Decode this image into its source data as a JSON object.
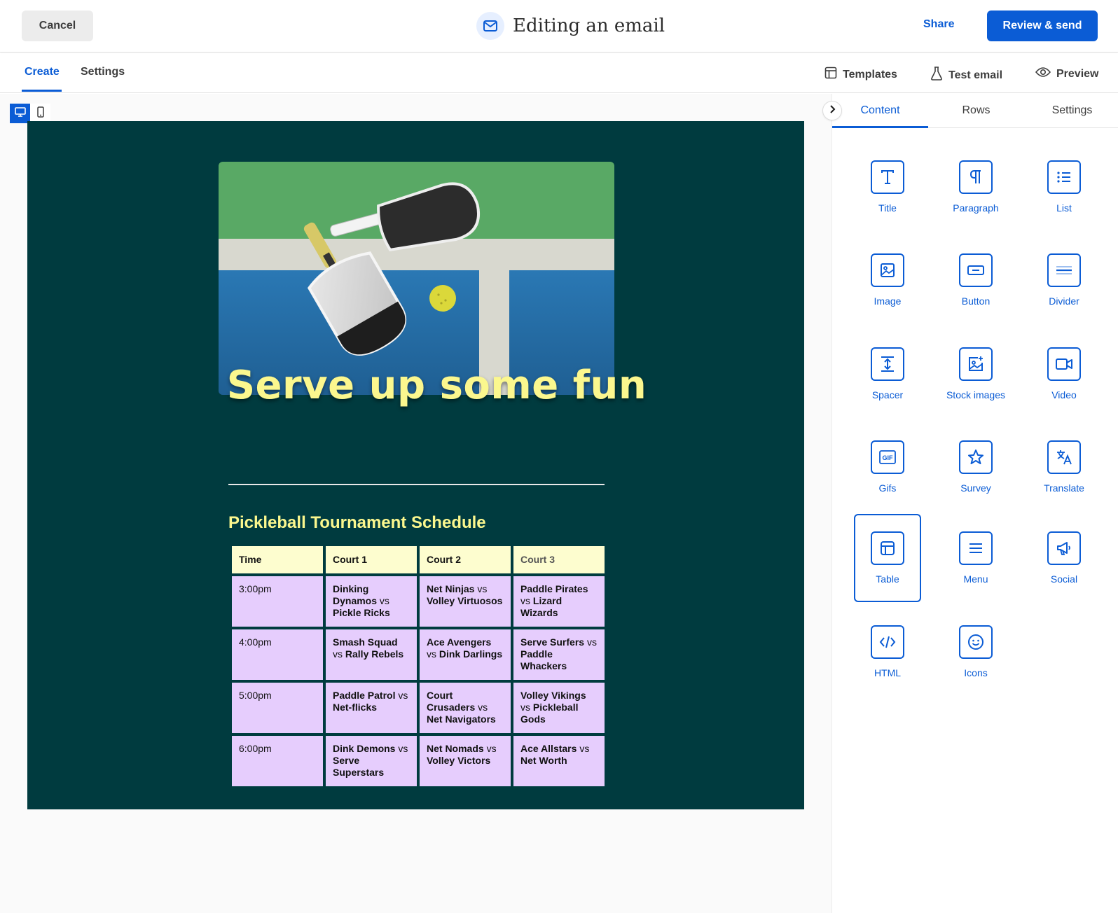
{
  "header": {
    "cancel_label": "Cancel",
    "title": "Editing an email",
    "share_label": "Share",
    "review_label": "Review & send",
    "accent_color": "#0b5cd5"
  },
  "subnav": {
    "tabs": [
      {
        "label": "Create",
        "active": true
      },
      {
        "label": "Settings",
        "active": false
      }
    ],
    "tools": [
      {
        "label": "Templates",
        "icon": "template-icon"
      },
      {
        "label": "Test email",
        "icon": "flask-icon"
      },
      {
        "label": "Preview",
        "icon": "eye-icon"
      }
    ]
  },
  "canvas": {
    "device_modes": [
      "desktop",
      "mobile"
    ],
    "active_device": "desktop",
    "email": {
      "background_color": "#003b3f",
      "headline": "Serve up some fun",
      "schedule_title": "Pickleball Tournament Schedule",
      "table": {
        "headers": [
          "Time",
          "Court 1",
          "Court 2",
          "Court 3"
        ],
        "rows": [
          {
            "time": "3:00pm",
            "c1": [
              "Dinking Dynamos",
              "Pickle Ricks"
            ],
            "c2": [
              "Net Ninjas",
              "Volley Virtuosos"
            ],
            "c3": [
              "Paddle Pirates",
              "Lizard Wizards"
            ]
          },
          {
            "time": "4:00pm",
            "c1": [
              "Smash Squad",
              "Rally Rebels"
            ],
            "c2": [
              "Ace Avengers",
              "Dink Darlings"
            ],
            "c3": [
              "Serve Surfers",
              "Paddle Whackers"
            ]
          },
          {
            "time": "5:00pm",
            "c1": [
              "Paddle Patrol",
              "Net-flicks"
            ],
            "c2": [
              "Court Crusaders",
              "Net Navigators"
            ],
            "c3": [
              "Volley Vikings",
              "Pickleball Gods"
            ]
          },
          {
            "time": "6:00pm",
            "c1": [
              "Dink Demons",
              "Serve Superstars"
            ],
            "c2": [
              "Net Nomads",
              "Volley Victors"
            ],
            "c3": [
              "Ace Allstars",
              "Net Worth"
            ]
          }
        ],
        "vs": "vs"
      }
    }
  },
  "panel": {
    "tabs": [
      {
        "label": "Content",
        "active": true
      },
      {
        "label": "Rows",
        "active": false
      },
      {
        "label": "Settings",
        "active": false
      }
    ],
    "blocks": [
      {
        "label": "Title",
        "icon": "title-icon"
      },
      {
        "label": "Paragraph",
        "icon": "paragraph-icon"
      },
      {
        "label": "List",
        "icon": "list-icon"
      },
      {
        "label": "Image",
        "icon": "image-icon"
      },
      {
        "label": "Button",
        "icon": "button-icon"
      },
      {
        "label": "Divider",
        "icon": "divider-icon"
      },
      {
        "label": "Spacer",
        "icon": "spacer-icon"
      },
      {
        "label": "Stock images",
        "icon": "stock-images-icon"
      },
      {
        "label": "Video",
        "icon": "video-icon"
      },
      {
        "label": "Gifs",
        "icon": "gif-icon"
      },
      {
        "label": "Survey",
        "icon": "star-icon"
      },
      {
        "label": "Translate",
        "icon": "translate-icon"
      },
      {
        "label": "Table",
        "icon": "table-icon",
        "selected": true
      },
      {
        "label": "Menu",
        "icon": "menu-icon"
      },
      {
        "label": "Social",
        "icon": "megaphone-icon"
      },
      {
        "label": "HTML",
        "icon": "code-icon"
      },
      {
        "label": "Icons",
        "icon": "smiley-icon"
      }
    ]
  }
}
